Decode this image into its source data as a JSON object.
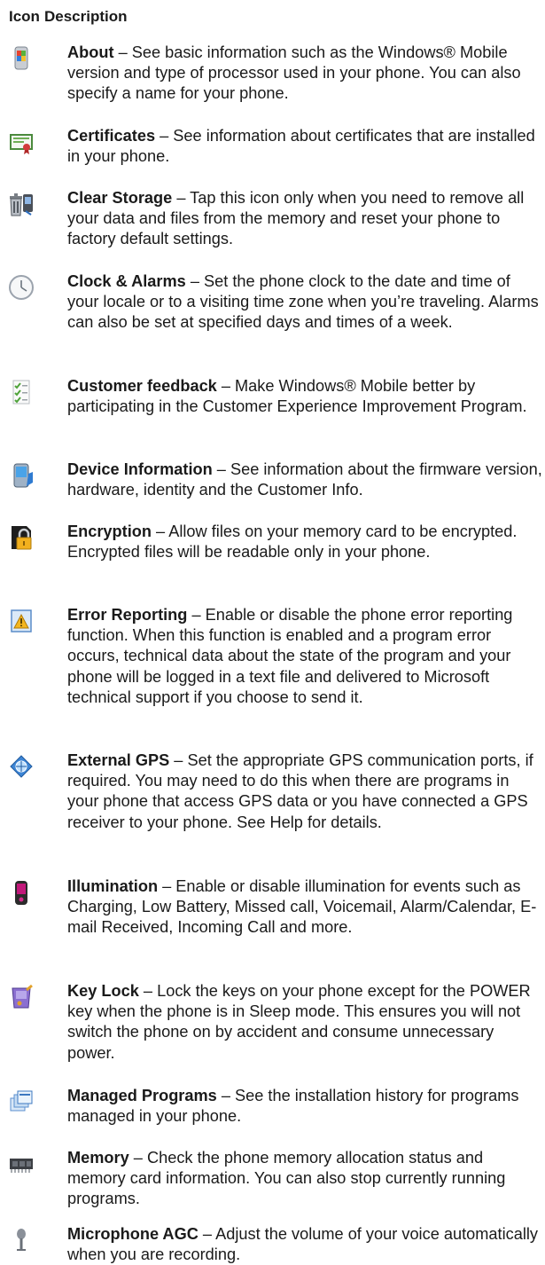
{
  "header": {
    "icon_col": "Icon",
    "desc_col": "Description"
  },
  "items": [
    {
      "icon": "about-icon",
      "term": "About",
      "desc": " – See basic information such as the Windows® Mobile version and type of processor used in your phone. You can also specify a name for your phone."
    },
    {
      "icon": "certificates-icon",
      "term": "Certificates",
      "desc": " – See information about certificates that are installed in your phone."
    },
    {
      "icon": "clear-storage-icon",
      "term": "Clear Storage",
      "desc": " – Tap this icon only when you need to remove all your data and files from the memory and reset your phone to factory default settings."
    },
    {
      "icon": "clock-icon",
      "term": "Clock & Alarms",
      "desc": " – Set the phone clock to the date and time of your locale or to a visiting time zone when you’re traveling. Alarms can also be set at specified days and times of a week."
    },
    {
      "icon": "customer-feedback-icon",
      "term": "Customer feedback",
      "desc": " – Make Windows® Mobile better by participating in the Customer Experience Improvement Program."
    },
    {
      "icon": "device-information-icon",
      "term": "Device Information",
      "desc": " – See information about the firmware version, hardware, identity and the Customer Info."
    },
    {
      "icon": "encryption-icon",
      "term": "Encryption",
      "desc": " – Allow files on your memory card to be encrypted. Encrypted files will be readable only in your phone."
    },
    {
      "icon": "error-reporting-icon",
      "term": "Error Reporting",
      "desc": " – Enable or disable the phone error reporting function. When this function is enabled and a program error occurs, technical data about the state of the program and your phone will be logged in a text file and delivered to Microsoft technical support if you choose to send it."
    },
    {
      "icon": "external-gps-icon",
      "term": "External GPS",
      "desc": " – Set the appropriate GPS communication ports, if required. You may need to do this when there are programs in your phone that access GPS data or you have connected a GPS receiver to your phone. See Help for details."
    },
    {
      "icon": "illumination-icon",
      "term": "Illumination",
      "desc": " – Enable or disable illumination for events such as Charging, Low Battery, Missed call, Voicemail, Alarm/Calendar, E-mail Received, Incoming Call and more."
    },
    {
      "icon": "key-lock-icon",
      "term": "Key Lock",
      "desc": " – Lock the keys on your phone except for the POWER key when the phone is in Sleep mode. This ensures you will not switch the phone on by accident and consume unnecessary power."
    },
    {
      "icon": "managed-programs-icon",
      "term": "Managed Programs",
      "desc": " – See the installation history for programs managed in your phone."
    },
    {
      "icon": "memory-icon",
      "term": "Memory",
      "desc": " – Check the phone memory allocation status and memory card information. You can also stop currently running programs."
    },
    {
      "icon": "microphone-icon",
      "term": "Microphone AGC",
      "desc": " – Adjust the volume of your voice automatically when you are recording."
    }
  ]
}
